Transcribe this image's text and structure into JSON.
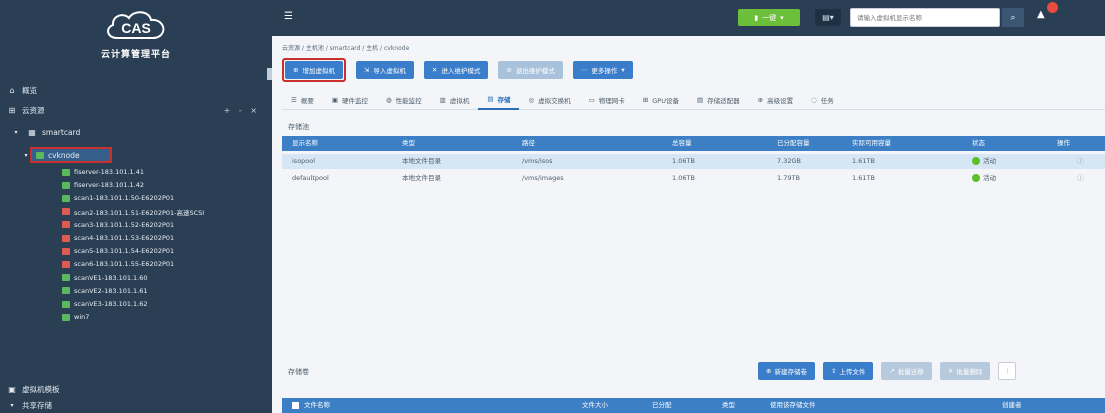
{
  "brand": {
    "logo_text": "CAS",
    "subtitle": "云计算管理平台"
  },
  "sidebar": {
    "overview": "概览",
    "resources": "云资源",
    "tree_tools": "+ - ×",
    "host_pool": "smartcard",
    "cluster": "cvknode",
    "vms": [
      {
        "label": "fiserver-183.101.1.41",
        "status": "green"
      },
      {
        "label": "fiserver-183.101.1.42",
        "status": "green"
      },
      {
        "label": "scan1-183.101.1.50-E6202P01",
        "status": "green"
      },
      {
        "label": "scan2-183.101.1.51-E6202P01-高速SCSI",
        "status": "red"
      },
      {
        "label": "scan3-183.101.1.52-E6202P01",
        "status": "red"
      },
      {
        "label": "scan4-183.101.1.53-E6202P01",
        "status": "red"
      },
      {
        "label": "scan5-183.101.1.54-E6202P01",
        "status": "red"
      },
      {
        "label": "scan6-183.101.1.55-E6202P01",
        "status": "red"
      },
      {
        "label": "scanVE1-183.101.1.60",
        "status": "green"
      },
      {
        "label": "scanVE2-183.101.1.61",
        "status": "green"
      },
      {
        "label": "scanVE3-183.101.1.62",
        "status": "green"
      },
      {
        "label": "win7",
        "status": "green"
      }
    ],
    "vm_template": "虚拟机模板",
    "shared_storage": "共享存储"
  },
  "topbar": {
    "green_btn": "一键",
    "search_placeholder": "请输入虚拟机显示名称"
  },
  "breadcrumb": "云资源 / 主机池 / smartcard / 主机 / cvknode",
  "actions": [
    {
      "label": "增加虚拟机",
      "style": "blue",
      "highlight": true
    },
    {
      "label": "导入虚拟机",
      "style": "blue"
    },
    {
      "label": "进入维护模式",
      "style": "blue"
    },
    {
      "label": "退出维护模式",
      "style": "dim"
    },
    {
      "label": "更多操作",
      "style": "blue"
    }
  ],
  "tabs": [
    {
      "label": "概要",
      "icon": "☰"
    },
    {
      "label": "硬件监控",
      "icon": "▣"
    },
    {
      "label": "性能监控",
      "icon": "◍"
    },
    {
      "label": "虚拟机",
      "icon": "▥"
    },
    {
      "label": "存储",
      "icon": "▤",
      "active": true
    },
    {
      "label": "虚拟交换机",
      "icon": "◎"
    },
    {
      "label": "物理网卡",
      "icon": "▭"
    },
    {
      "label": "GPU设备",
      "icon": "⊞"
    },
    {
      "label": "存储适配器",
      "icon": "▤"
    },
    {
      "label": "高级设置",
      "icon": "⊕"
    },
    {
      "label": "任务",
      "icon": "◌"
    }
  ],
  "storage_pool": {
    "title": "存储池",
    "columns": [
      "显示名称",
      "类型",
      "路径",
      "总容量",
      "已分配容量",
      "实际可用容量",
      "状态",
      "操作"
    ],
    "rows": [
      {
        "name": "isopool",
        "type": "本地文件目录",
        "path": "/vms/isos",
        "total": "1.06TB",
        "allocated": "7.32GB",
        "available": "1.61TB",
        "status": "活动",
        "selected": true
      },
      {
        "name": "defaultpool",
        "type": "本地文件目录",
        "path": "/vms/images",
        "total": "1.06TB",
        "allocated": "1.79TB",
        "available": "1.61TB",
        "status": "活动",
        "selected": false
      }
    ]
  },
  "storage_volume": {
    "title": "存储卷",
    "buttons": [
      "新建存储卷",
      "上传文件",
      "批量迁移",
      "批量删除"
    ],
    "columns": [
      "文件名称",
      "文件大小",
      "已分配",
      "类型",
      "使用该存储文件",
      "创建者"
    ]
  },
  "colors": {
    "sidebar_bg": "#2a3f54",
    "accent": "#3a7ecb",
    "status_green": "#5cbf2a",
    "highlight_red": "#c9302c"
  }
}
